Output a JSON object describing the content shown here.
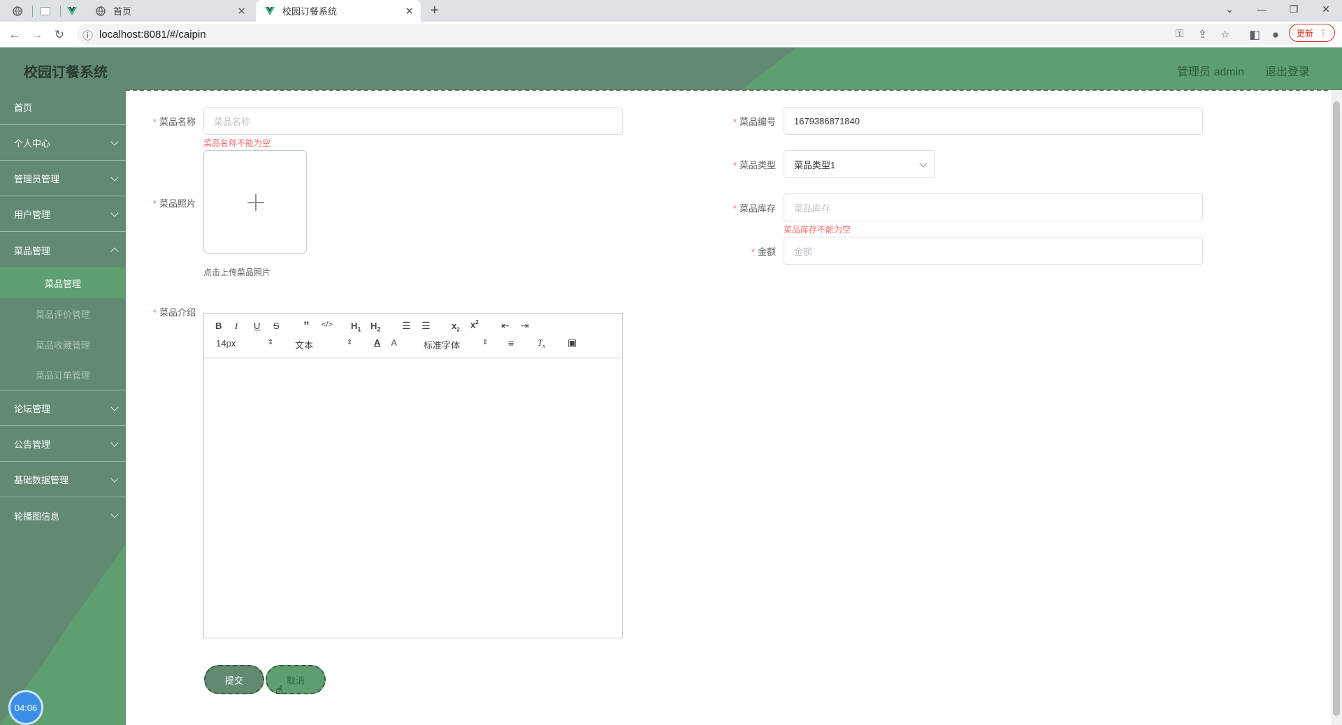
{
  "browser": {
    "tabs": [
      {
        "label": ""
      },
      {
        "label": ""
      },
      {
        "label": ""
      },
      {
        "label": "首页"
      },
      {
        "label": "校园订餐系统"
      }
    ],
    "url": "localhost:8081/#/caipin",
    "update_label": "更新"
  },
  "header": {
    "title": "校园订餐系统",
    "admin": "管理员 admin",
    "logout": "退出登录"
  },
  "sidebar": {
    "items": [
      {
        "label": "首页"
      },
      {
        "label": "个人中心"
      },
      {
        "label": "管理员管理"
      },
      {
        "label": "用户管理"
      },
      {
        "label": "菜品管理"
      },
      {
        "label": "论坛管理"
      },
      {
        "label": "公告管理"
      },
      {
        "label": "基础数据管理"
      },
      {
        "label": "轮播图信息"
      }
    ],
    "subitems": [
      {
        "label": "菜品管理"
      },
      {
        "label": "菜品评价管理"
      },
      {
        "label": "菜品收藏管理"
      },
      {
        "label": "菜品订单管理"
      }
    ],
    "clock": "04:06"
  },
  "form": {
    "name": {
      "label": "菜品名称",
      "placeholder": "菜品名称",
      "error": "菜品名称不能为空"
    },
    "photo": {
      "label": "菜品照片",
      "tip": "点击上传菜品照片"
    },
    "intro": {
      "label": "菜品介绍"
    },
    "code": {
      "label": "菜品编号",
      "value": "1679386871840"
    },
    "type": {
      "label": "菜品类型",
      "value": "菜品类型1"
    },
    "stock": {
      "label": "菜品库存",
      "placeholder": "菜品库存",
      "error": "菜品库存不能为空"
    },
    "amount": {
      "label": "金额",
      "placeholder": "金额"
    },
    "submit": "提交",
    "cancel": "取消"
  },
  "editor": {
    "font_size": "14px",
    "header": "文本",
    "font": "标准字体"
  }
}
